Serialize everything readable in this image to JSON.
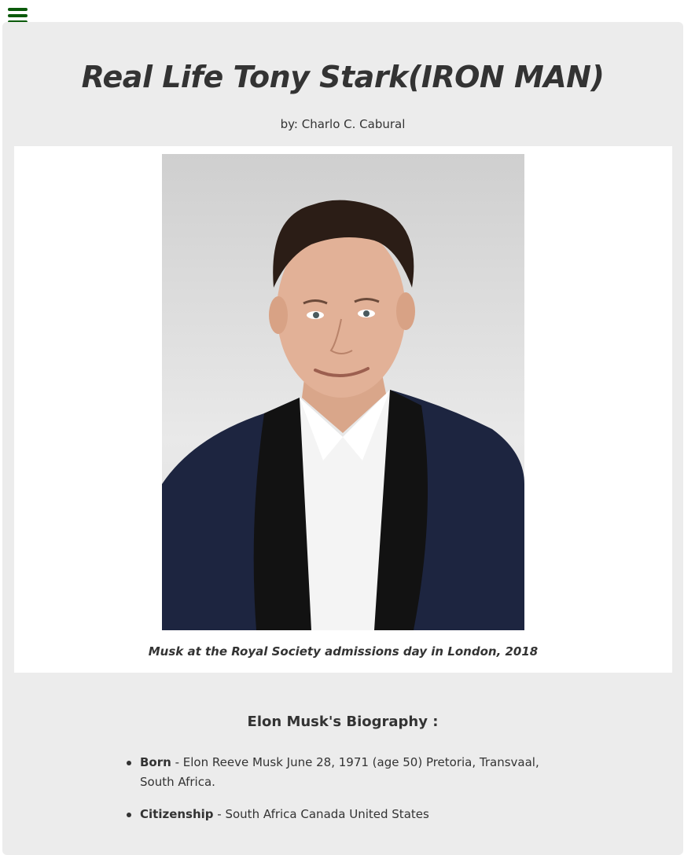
{
  "nav": {
    "menu_icon": "hamburger-menu-icon",
    "menu_color": "#0b5a0b"
  },
  "header": {
    "title": "Real Life Tony Stark(IRON MAN)",
    "byline": "by: Charlo C. Cabural"
  },
  "figure": {
    "image_subject": "portrait-photo",
    "caption": "Musk at the Royal Society admissions day in London, 2018"
  },
  "bio": {
    "heading": "Elon Musk's Biography :",
    "items": [
      {
        "label": "Born",
        "text": " - Elon Reeve Musk June 28, 1971 (age 50) Pretoria, Transvaal, South Africa."
      },
      {
        "label": "Citizenship",
        "text": " - South Africa Canada United States"
      }
    ]
  },
  "colors": {
    "panel_background": "#ececec",
    "text": "#333333"
  }
}
